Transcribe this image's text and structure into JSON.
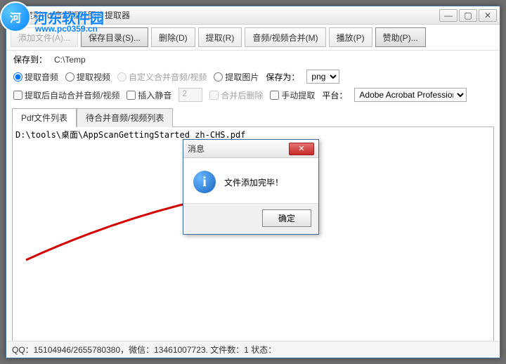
{
  "window": {
    "title": "度彩Pdf音频视频图片提取器"
  },
  "watermark": {
    "brand": "河东软件园",
    "url": "www.pc0359.cn"
  },
  "toolbar": {
    "add_file": "添加文件(A)...",
    "save_dir": "保存目录(S)...",
    "delete": "删除(D)",
    "extract": "提取(R)",
    "av_merge": "音频/视频合并(M)",
    "play": "播放(P)",
    "sponsor": "赞助(P)..."
  },
  "options": {
    "save_to_label": "保存到：",
    "save_to_path": "C:\\Temp",
    "extract_audio": "提取音频",
    "extract_video": "提取视频",
    "custom_merge": "自定义合并音频/视频",
    "extract_image": "提取图片",
    "save_as": "保存为：",
    "format": "png",
    "auto_merge": "提取后自动合并音频/视频",
    "insert_silence": "插入静音",
    "silence_sec": "2",
    "delete_after_merge": "合并后删除",
    "manual_extract": "手动提取",
    "platform_label": "平台：",
    "platform": "Adobe Acrobat Professional"
  },
  "tabs": {
    "pdf_list": "Pdf文件列表",
    "merge_list": "待合并音频/视频列表"
  },
  "list": {
    "items": [
      "D:\\tools\\桌面\\AppScanGettingStarted_zh-CHS.pdf"
    ]
  },
  "dialog": {
    "title": "消息",
    "message": "文件添加完毕！",
    "ok": "确定"
  },
  "status": {
    "text": "QQ：15104946/2655780380，微信：13461007723.  文件数：1  状态："
  }
}
